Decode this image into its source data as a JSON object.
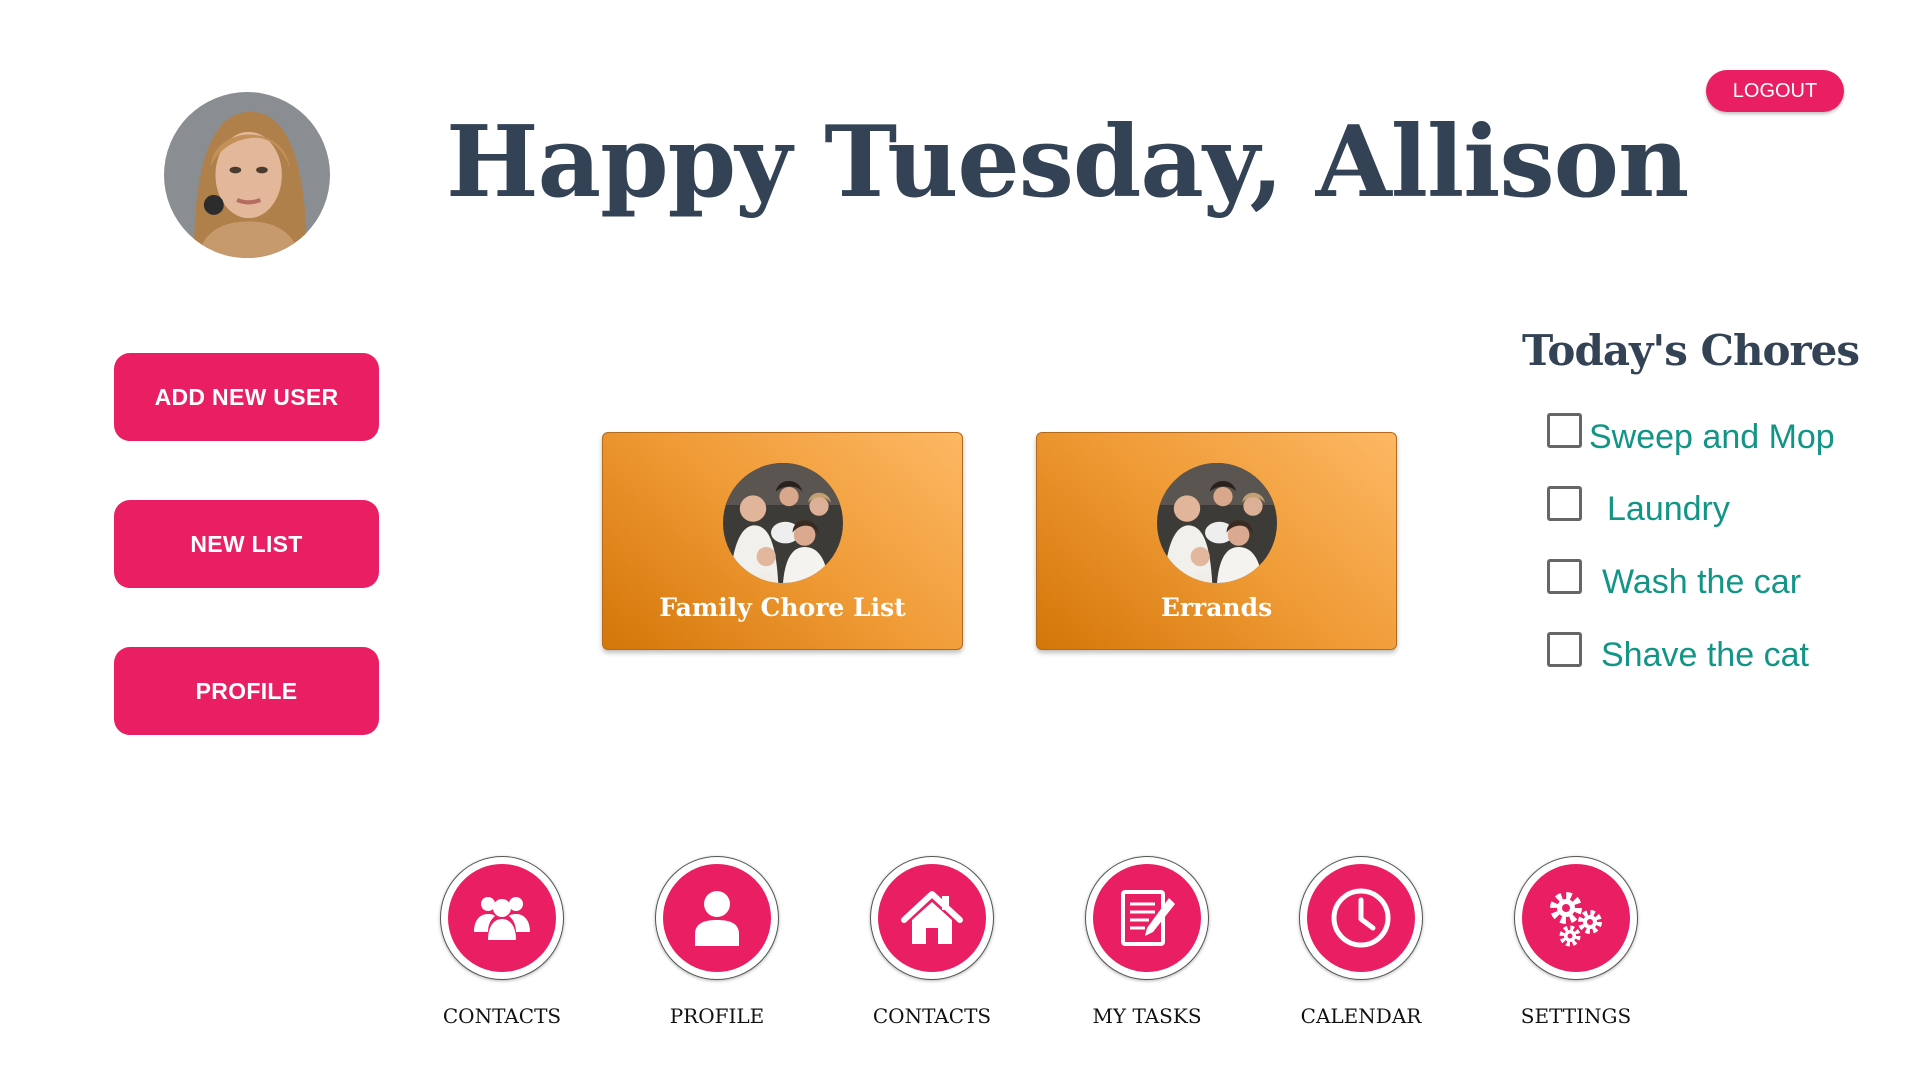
{
  "header": {
    "greeting": "Happy Tuesday, Allison",
    "logout_label": "LOGOUT"
  },
  "sidebar": {
    "buttons": [
      {
        "label": "ADD NEW USER"
      },
      {
        "label": "NEW LIST"
      },
      {
        "label": "PROFILE"
      }
    ]
  },
  "lists": [
    {
      "label": "Family Chore List"
    },
    {
      "label": "Errands"
    }
  ],
  "chores": {
    "title": "Today's Chores",
    "items": [
      {
        "label": "Sweep and Mop",
        "checked": false
      },
      {
        "label": "Laundry",
        "checked": false
      },
      {
        "label": "Wash the car",
        "checked": false
      },
      {
        "label": "Shave the cat",
        "checked": false
      }
    ]
  },
  "bottom_nav": [
    {
      "label": "CONTACTS",
      "icon": "people-icon"
    },
    {
      "label": "PROFILE",
      "icon": "person-icon"
    },
    {
      "label": "CONTACTS",
      "icon": "home-icon"
    },
    {
      "label": "MY TASKS",
      "icon": "tasks-icon"
    },
    {
      "label": "CALENDAR",
      "icon": "clock-icon"
    },
    {
      "label": "SETTINGS",
      "icon": "gears-icon"
    }
  ],
  "colors": {
    "accent": "#e91e63",
    "heading": "#334255",
    "chore_text": "#129586",
    "card_gradient": [
      "#fdb863",
      "#d47608"
    ]
  }
}
